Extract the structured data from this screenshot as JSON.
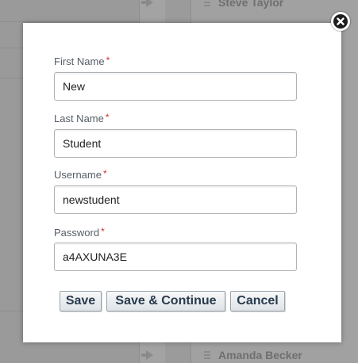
{
  "background": {
    "top_name": "Steve Taylor",
    "bottom_name": "Amanda Becker"
  },
  "form": {
    "required_marker": "*",
    "fields": [
      {
        "label": "First Name",
        "value": "New"
      },
      {
        "label": "Last Name",
        "value": "Student"
      },
      {
        "label": "Username",
        "value": "newstudent"
      },
      {
        "label": "Password",
        "value": "a4AXUNA3E"
      }
    ]
  },
  "buttons": {
    "save": "Save",
    "save_continue": "Save & Continue",
    "cancel": "Cancel"
  },
  "icons": {
    "close": "close-icon"
  },
  "colors": {
    "required": "#d0312d",
    "button_text": "#283a4d",
    "label": "#555d66"
  }
}
